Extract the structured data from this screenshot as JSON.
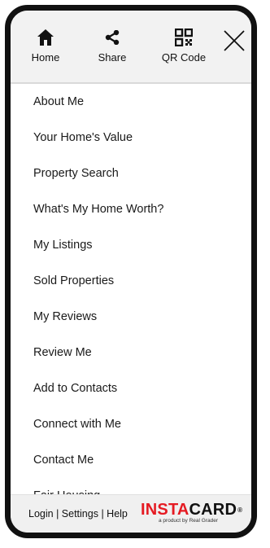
{
  "nav": {
    "home_label": "Home",
    "share_label": "Share",
    "qr_label": "QR Code"
  },
  "menu": {
    "items": [
      "About Me",
      "Your Home's Value",
      "Property Search",
      "What's My Home Worth?",
      "My Listings",
      "Sold Properties",
      "My Reviews",
      "Review Me",
      "Add to Contacts",
      "Connect with Me",
      "Contact Me",
      "Fair Housing"
    ]
  },
  "footer": {
    "login": "Login",
    "settings": "Settings",
    "help": "Help",
    "separator": " | ",
    "brand_insta": "INSTA",
    "brand_card": "CARD",
    "brand_reg": "®",
    "brand_sub": "a product by Real Grader"
  },
  "colors": {
    "brand_red": "#e51b23",
    "frame": "#111111",
    "header_bg": "#f2f2f2"
  },
  "icons": [
    "home-icon",
    "share-icon",
    "qr-code-icon",
    "close-icon"
  ]
}
